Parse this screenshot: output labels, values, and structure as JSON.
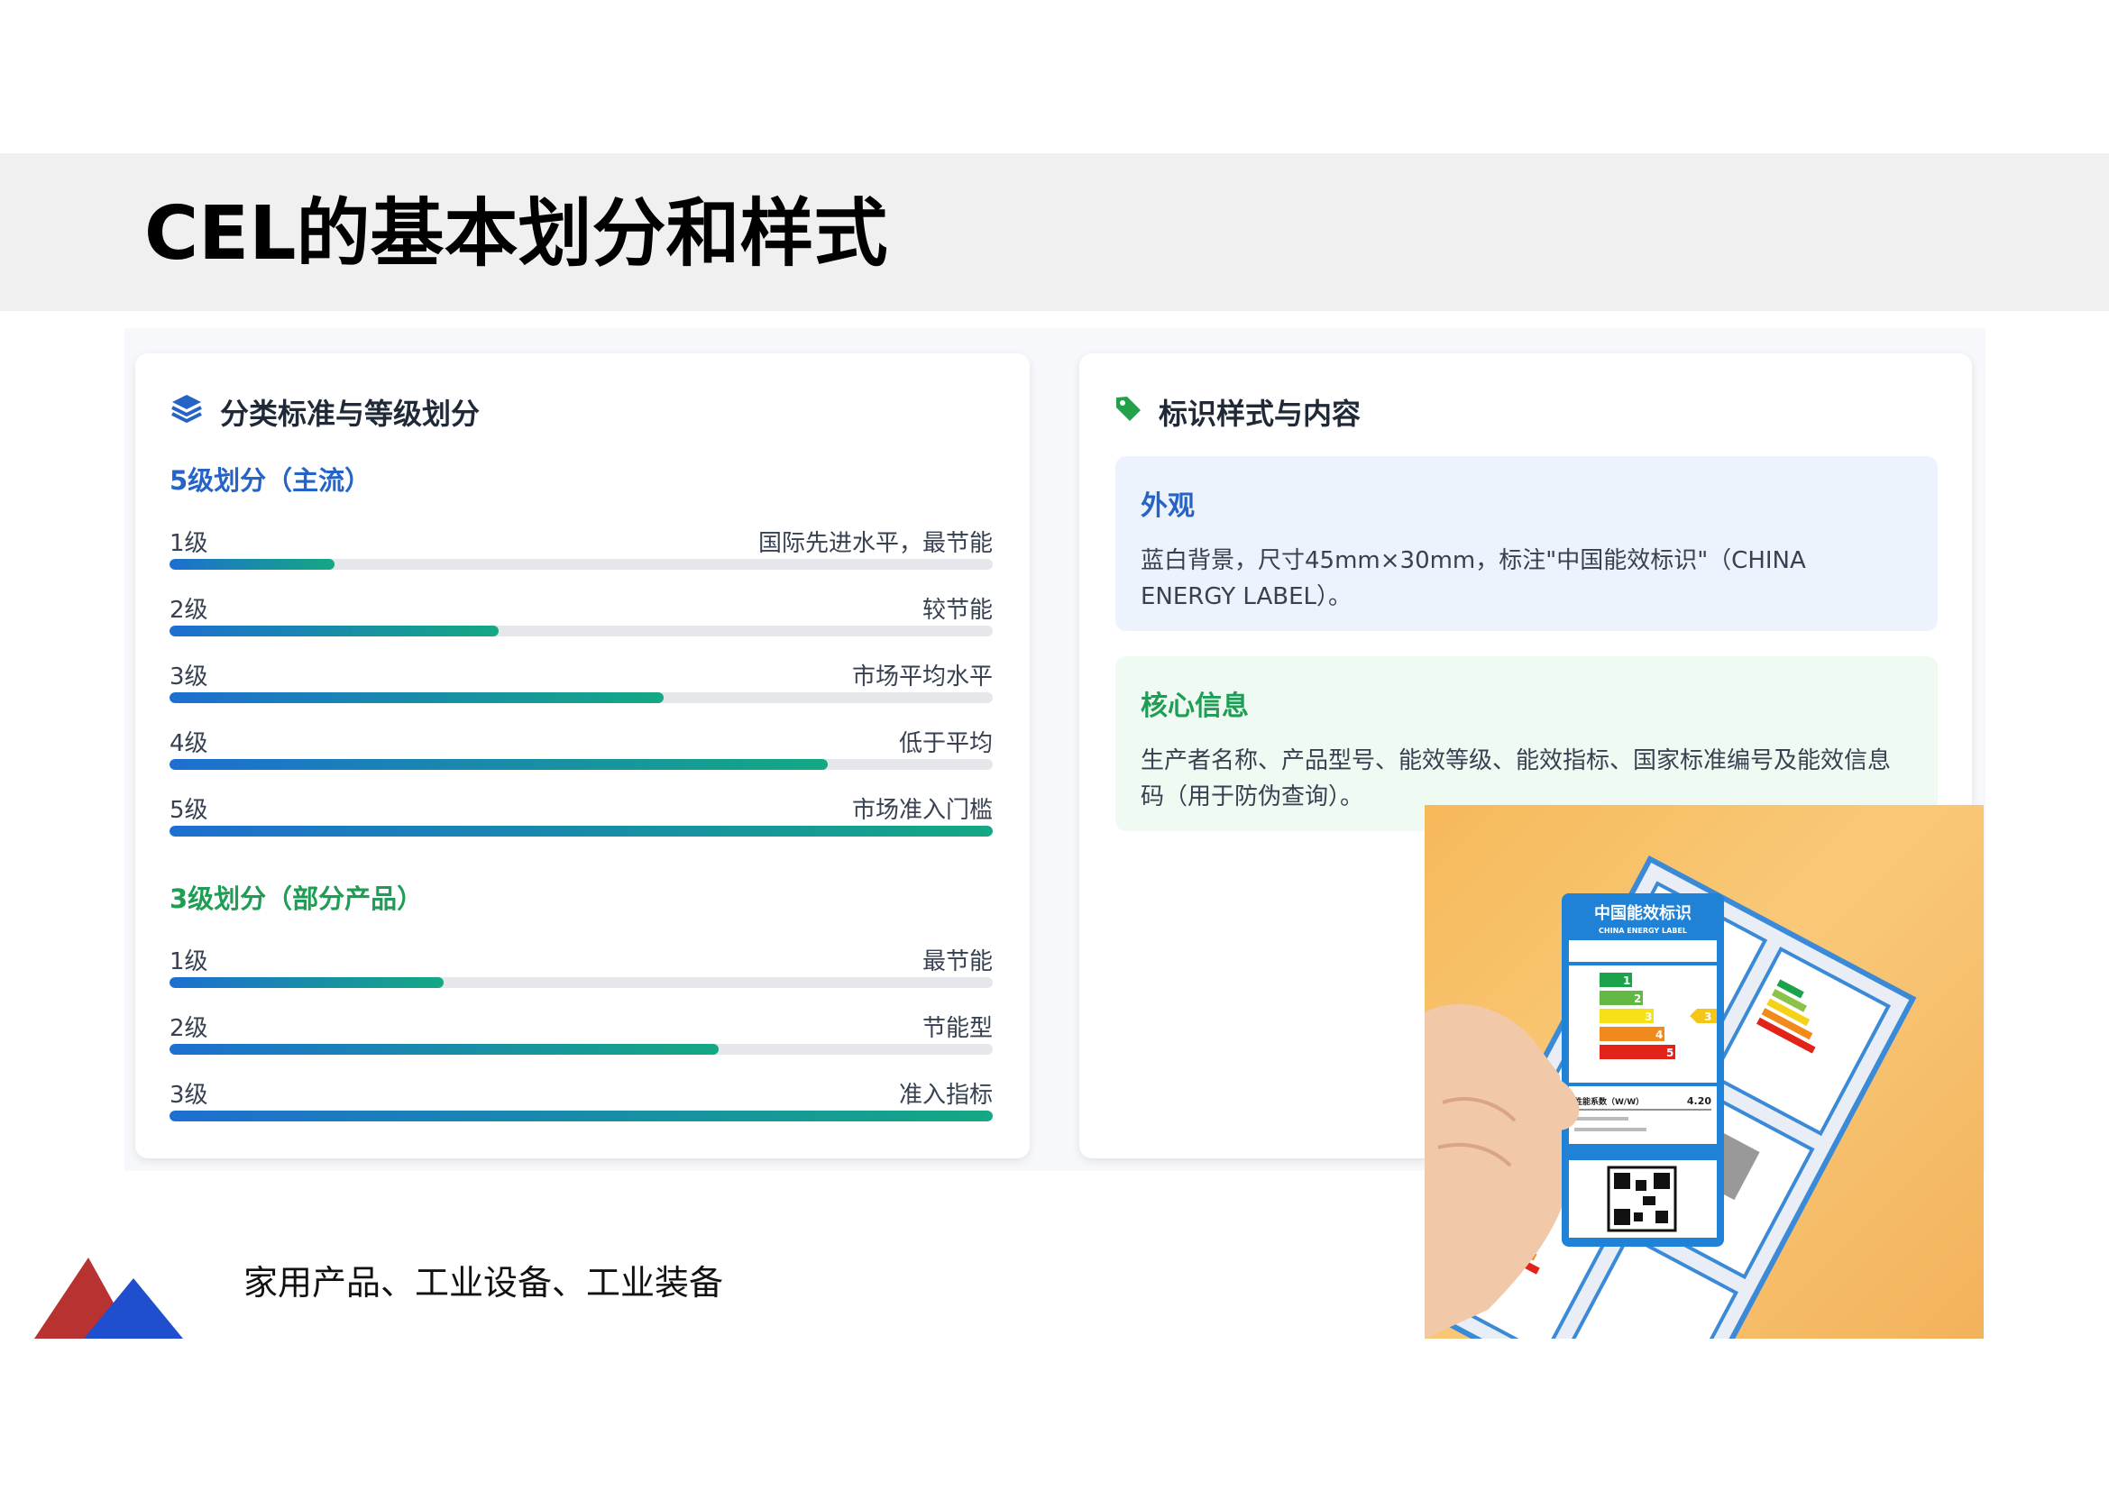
{
  "page": {
    "title": "CEL的基本划分和样式",
    "footer": "家用产品、工业设备、工业装备"
  },
  "left_card": {
    "header": "分类标准与等级划分",
    "icon": "layers-icon",
    "section5": {
      "title": "5级划分（主流）",
      "levels": [
        {
          "label": "1级",
          "desc": "国际先进水平，最节能",
          "fill": 0.2
        },
        {
          "label": "2级",
          "desc": "较节能",
          "fill": 0.4
        },
        {
          "label": "3级",
          "desc": "市场平均水平",
          "fill": 0.6
        },
        {
          "label": "4级",
          "desc": "低于平均",
          "fill": 0.8
        },
        {
          "label": "5级",
          "desc": "市场准入门槛",
          "fill": 1.0
        }
      ]
    },
    "section3": {
      "title": "3级划分（部分产品）",
      "levels": [
        {
          "label": "1级",
          "desc": "最节能",
          "fill": 0.333
        },
        {
          "label": "2级",
          "desc": "节能型",
          "fill": 0.667
        },
        {
          "label": "3级",
          "desc": "准入指标",
          "fill": 1.0
        }
      ]
    }
  },
  "right_card": {
    "header": "标识样式与内容",
    "icon": "tag-icon",
    "appearance": {
      "title": "外观",
      "text_line1": "蓝白背景，尺寸45mm×30mm，标注\"中国能效标识\"（CHINA",
      "text_line2": "ENERGY LABEL）。"
    },
    "core": {
      "title": "核心信息",
      "text_line1": "生产者名称、产品型号、能效等级、能效指标、国家标准编号及能效信息",
      "text_line2": "码（用于防伪查询）。"
    }
  },
  "photo": {
    "label_title": "中国能效标识",
    "label_subtitle": "CHINA ENERGY LABEL",
    "grades": [
      "1",
      "2",
      "3",
      "4",
      "5"
    ],
    "marker": "3",
    "metric_label": "性能系数（W/W）",
    "metric_value": "4.20"
  },
  "colors": {
    "accent_blue": "#2563c7",
    "accent_green": "#1f9d55",
    "bar_start": "#1d6fd1",
    "bar_end": "#14a883",
    "logo_red": "#b83232",
    "logo_blue": "#1f4fcf"
  }
}
